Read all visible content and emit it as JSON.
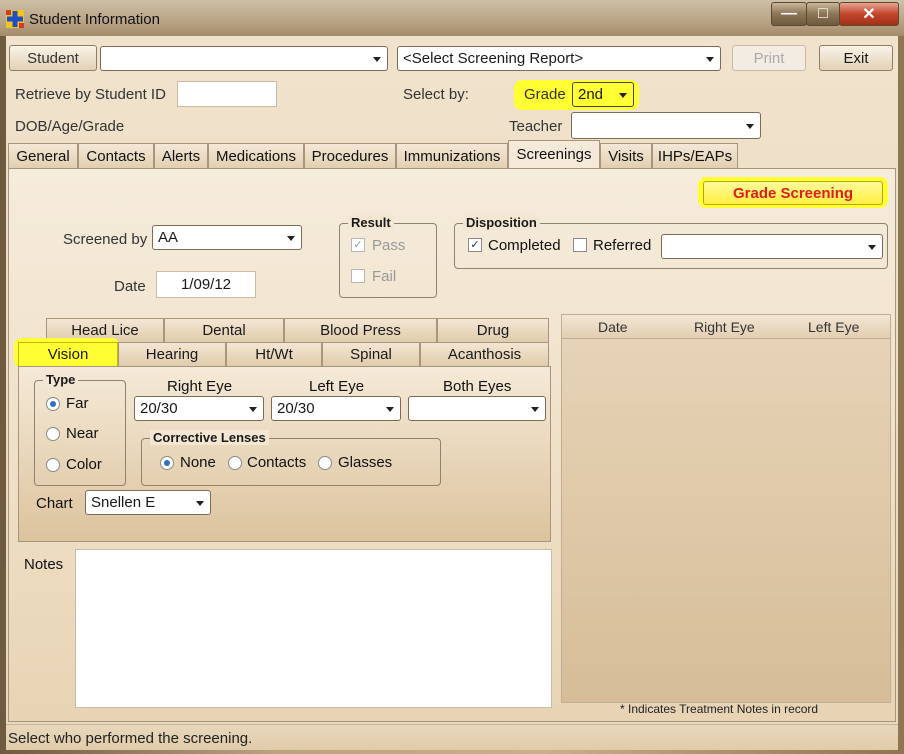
{
  "window": {
    "title": "Student Information",
    "controls": {
      "minimize": "—",
      "maximize": "□",
      "close": "✕"
    }
  },
  "header": {
    "student_label": "Student",
    "student_value": "",
    "report_select": "<Select Screening Report>",
    "print_label": "Print",
    "exit_label": "Exit",
    "retrieve_label": "Retrieve by Student ID",
    "retrieve_value": "",
    "select_by_label": "Select by:",
    "grade_label": "Grade",
    "grade_value": "2nd",
    "dob_label": "DOB/Age/Grade",
    "teacher_label": "Teacher",
    "teacher_value": ""
  },
  "tabs": [
    {
      "label": "General"
    },
    {
      "label": "Contacts"
    },
    {
      "label": "Alerts"
    },
    {
      "label": "Medications"
    },
    {
      "label": "Procedures"
    },
    {
      "label": "Immunizations"
    },
    {
      "label": "Screenings"
    },
    {
      "label": "Visits"
    },
    {
      "label": "IHPs/EAPs"
    }
  ],
  "screening": {
    "grade_screening_button": "Grade Screening",
    "screened_by_label": "Screened by",
    "screened_by_value": "AA",
    "date_label": "Date",
    "date_value": "1/09/12",
    "result_title": "Result",
    "pass_label": "Pass",
    "fail_label": "Fail",
    "disposition_title": "Disposition",
    "completed_label": "Completed",
    "referred_label": "Referred",
    "referred_value": "",
    "check_mark": "✓"
  },
  "screen_tabs_top": [
    {
      "label": "Head Lice"
    },
    {
      "label": "Dental"
    },
    {
      "label": "Blood Press"
    },
    {
      "label": "Drug"
    }
  ],
  "screen_tabs_bottom": [
    {
      "label": "Vision"
    },
    {
      "label": "Hearing"
    },
    {
      "label": "Ht/Wt"
    },
    {
      "label": "Spinal"
    },
    {
      "label": "Acanthosis"
    }
  ],
  "vision": {
    "type_title": "Type",
    "type_options": [
      "Far",
      "Near",
      "Color"
    ],
    "right_eye_label": "Right Eye",
    "right_eye_value": "20/30",
    "left_eye_label": "Left Eye",
    "left_eye_value": "20/30",
    "both_eyes_label": "Both Eyes",
    "both_eyes_value": "",
    "lenses_title": "Corrective Lenses",
    "lenses_options": [
      "None",
      "Contacts",
      "Glasses"
    ],
    "chart_label": "Chart",
    "chart_value": "Snellen E"
  },
  "notes": {
    "label": "Notes",
    "value": ""
  },
  "history_grid": {
    "columns": [
      "Date",
      "Right Eye",
      "Left Eye"
    ],
    "footnote": "* Indicates Treatment Notes in record"
  },
  "status": {
    "text": "Select who performed the screening."
  },
  "colors": {
    "highlight": "#ffff33",
    "grade_screening_text": "#e11d1d",
    "radio_selected": "#2f6fc4"
  }
}
